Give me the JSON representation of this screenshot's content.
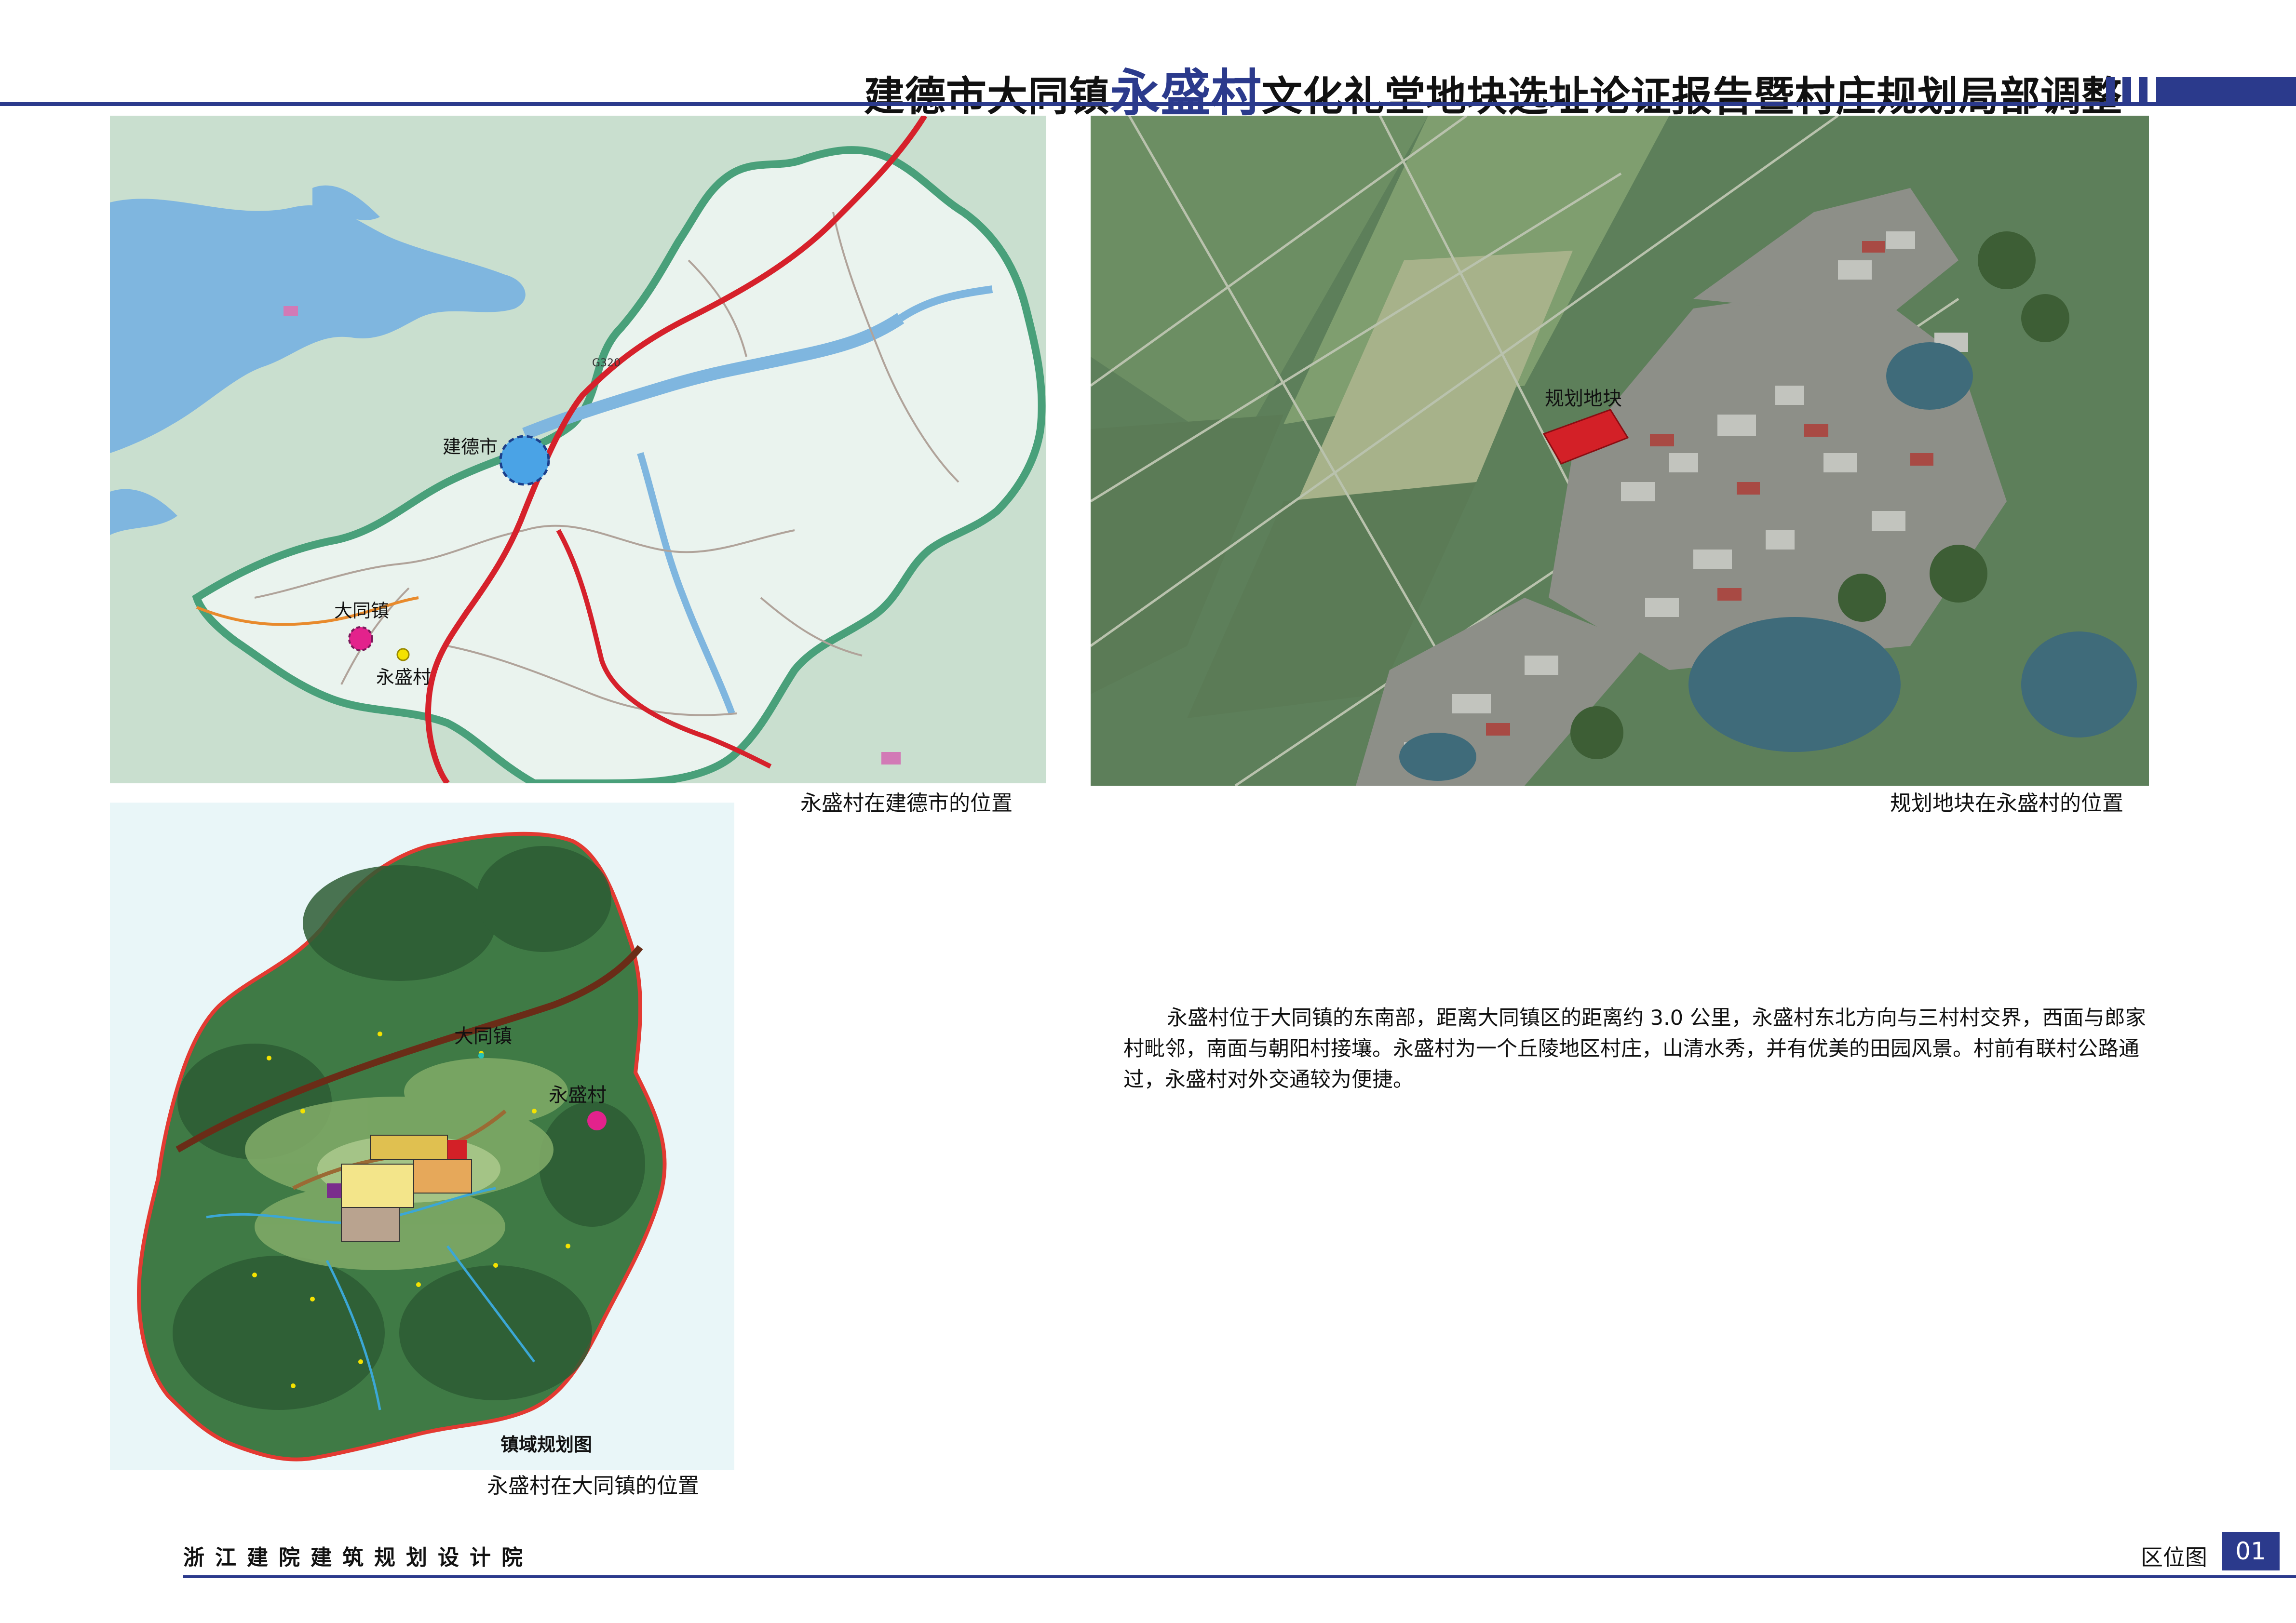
{
  "header": {
    "title_prefix": "建德市大同镇",
    "title_highlight": "永盛村",
    "title_suffix": "文化礼堂地块选址论证报告暨村庄规划局部调整"
  },
  "map_city": {
    "caption": "永盛村在建德市的位置",
    "label_city": "建德市",
    "label_town": "大同镇",
    "label_village": "永盛村",
    "road_label": "G320"
  },
  "map_satellite": {
    "caption": "规划地块在永盛村的位置",
    "label_site": "规划地块"
  },
  "map_town": {
    "caption": "永盛村在大同镇的位置",
    "map_title": "镇域规划图",
    "label_town": "大同镇",
    "label_village": "永盛村"
  },
  "description": "永盛村位于大同镇的东南部，距离大同镇区的距离约 3.0 公里，永盛村东北方向与三村村交界，西面与郎家村毗邻，南面与朝阳村接壤。永盛村为一个丘陵地区村庄，山清水秀，并有优美的田园风景。村前有联村公路通过，永盛村对外交通较为便捷。",
  "footer": {
    "org": "浙江建院建筑规划设计院",
    "sheet_name": "区位图",
    "sheet_number": "01"
  },
  "colors": {
    "accent": "#2b3a8c",
    "water": "#7fb6df",
    "land": "#e8f1ec",
    "boundary": "#49a07a",
    "road_red": "#d6212b",
    "site_red": "#d32027",
    "village_marker": "#e3228c"
  }
}
